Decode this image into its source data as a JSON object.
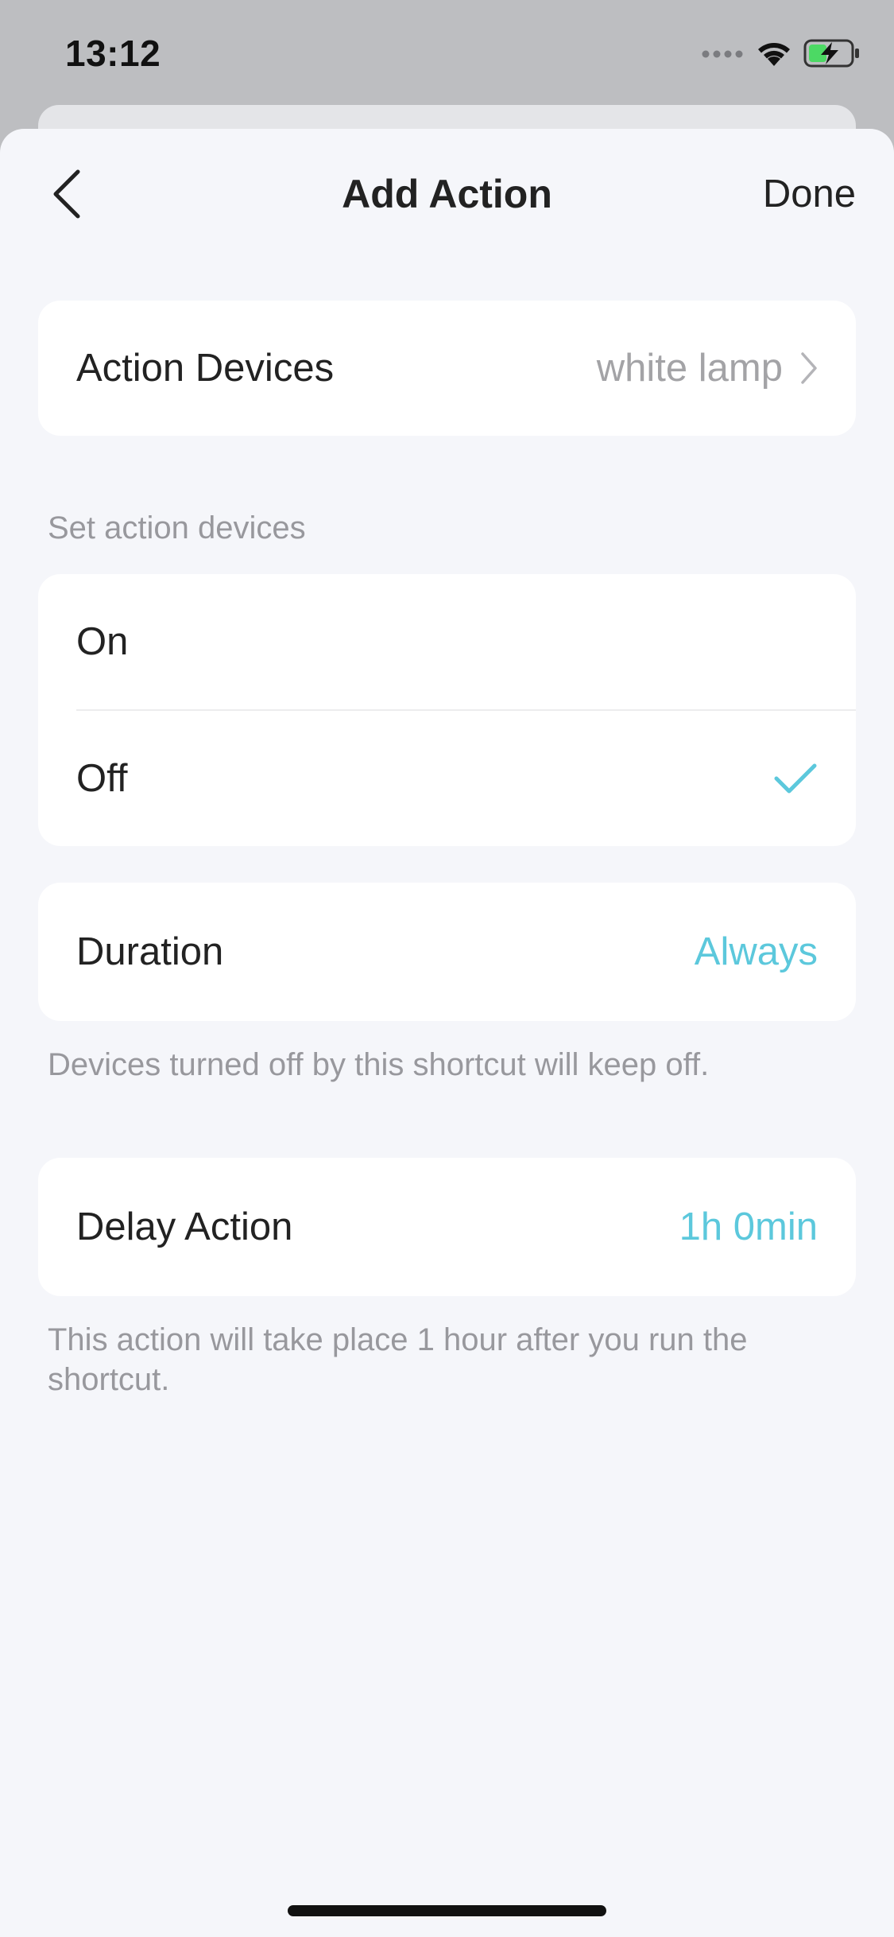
{
  "status_bar": {
    "time": "13:12",
    "signal_icon": "signal-dots-icon",
    "wifi_icon": "wifi-icon",
    "battery_icon": "battery-charging-icon"
  },
  "nav": {
    "back_icon": "chevron-left-icon",
    "title": "Add Action",
    "done_label": "Done"
  },
  "action_devices": {
    "label": "Action Devices",
    "value": "white lamp",
    "chevron_icon": "chevron-right-icon"
  },
  "set_action": {
    "header": "Set action devices",
    "options": [
      {
        "label": "On",
        "selected": false
      },
      {
        "label": "Off",
        "selected": true
      }
    ],
    "check_icon": "checkmark-icon"
  },
  "duration": {
    "label": "Duration",
    "value": "Always",
    "note": "Devices turned off by this shortcut will keep off."
  },
  "delay": {
    "label": "Delay Action",
    "value": "1h 0min",
    "note": "This action will take place 1 hour after you run the shortcut."
  },
  "colors": {
    "accent": "#5cc8dc",
    "background": "#f5f6fa",
    "card": "#ffffff",
    "secondary_text": "#98989d"
  }
}
